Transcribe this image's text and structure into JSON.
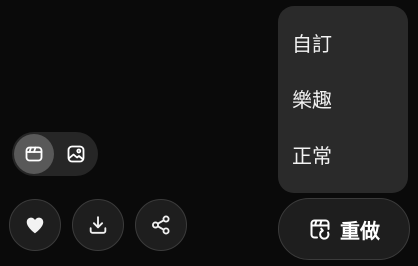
{
  "style_menu": {
    "items": [
      {
        "label": "自訂"
      },
      {
        "label": "樂趣"
      },
      {
        "label": "正常"
      }
    ]
  },
  "mode_toggle": {
    "active": "clip",
    "options": [
      {
        "icon": "clapperboard-icon"
      },
      {
        "icon": "image-icon"
      }
    ]
  },
  "actions": {
    "like_icon": "heart-icon",
    "download_icon": "download-icon",
    "share_icon": "share-icon"
  },
  "redo": {
    "label": "重做",
    "icon": "clapperboard-redo-icon"
  },
  "colors": {
    "background": "#0a0a0a",
    "menu_background": "#2a2a2a",
    "button_background": "#1e1e1e",
    "button_border": "#3b3b3b",
    "toggle_active": "#595959",
    "text": "#f2f2f2"
  }
}
